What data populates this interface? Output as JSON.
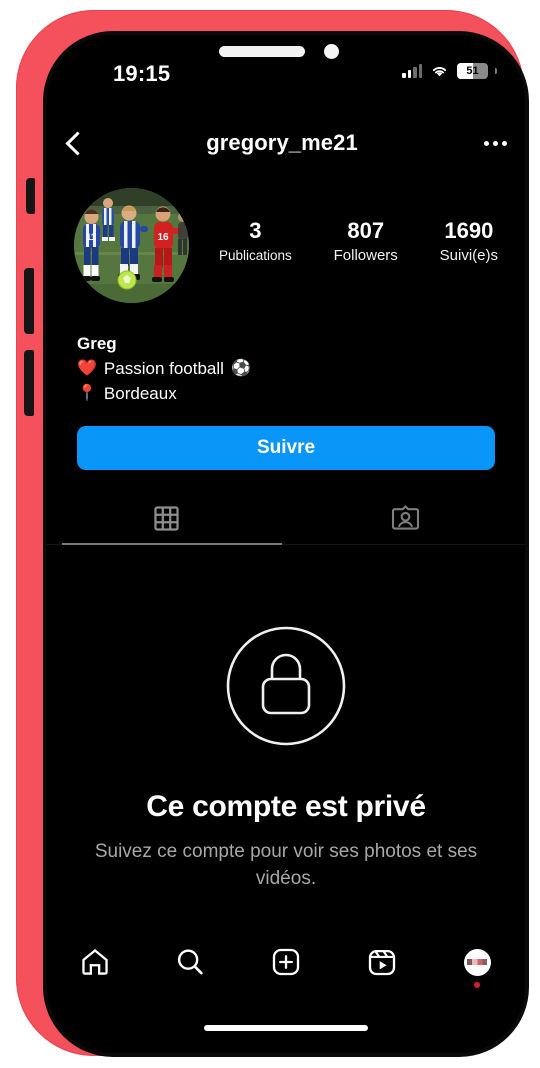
{
  "device": {
    "case_color": "#f4515c",
    "screen_bg": "#000000"
  },
  "status_bar": {
    "time": "19:15",
    "battery_percent": "51",
    "battery_level": 51,
    "signal_icon": "cellular-signal-icon",
    "wifi_icon": "wifi-icon",
    "battery_icon": "battery-icon"
  },
  "header": {
    "back_icon": "chevron-left-icon",
    "username": "gregory_me21",
    "more_icon": "more-options-icon"
  },
  "profile": {
    "avatar_alt": "youth-football-match-photo",
    "stats": [
      {
        "number": "3",
        "label": "Publications"
      },
      {
        "number": "807",
        "label": "Followers"
      },
      {
        "number": "1690",
        "label": "Suivi(e)s"
      }
    ],
    "bio": {
      "name": "Greg",
      "lines": [
        {
          "emoji": "❤️",
          "emoji_name": "red-heart-emoji",
          "text": "Passion football",
          "trailing_emoji": "⚽",
          "trailing_emoji_name": "soccer-ball-emoji"
        },
        {
          "emoji": "📍",
          "emoji_name": "round-pushpin-emoji",
          "text": "Bordeaux",
          "trailing_emoji": "",
          "trailing_emoji_name": ""
        }
      ]
    },
    "follow_button": {
      "label": "Suivre",
      "color": "#0a95f8"
    }
  },
  "tabs": [
    {
      "name": "grid-tab",
      "icon": "grid-icon",
      "active": true
    },
    {
      "name": "tagged-tab",
      "icon": "tagged-person-icon",
      "active": false
    }
  ],
  "private_account": {
    "lock_icon": "lock-circle-icon",
    "title": "Ce compte est privé",
    "subtitle": "Suivez ce compte pour voir ses photos et ses vidéos."
  },
  "bottom_nav": [
    {
      "name": "nav-home",
      "icon": "home-icon"
    },
    {
      "name": "nav-search",
      "icon": "search-icon"
    },
    {
      "name": "nav-create",
      "icon": "plus-square-icon"
    },
    {
      "name": "nav-reels",
      "icon": "reels-icon"
    },
    {
      "name": "nav-profile",
      "icon": "profile-avatar-icon",
      "has_notification_dot": true
    }
  ]
}
